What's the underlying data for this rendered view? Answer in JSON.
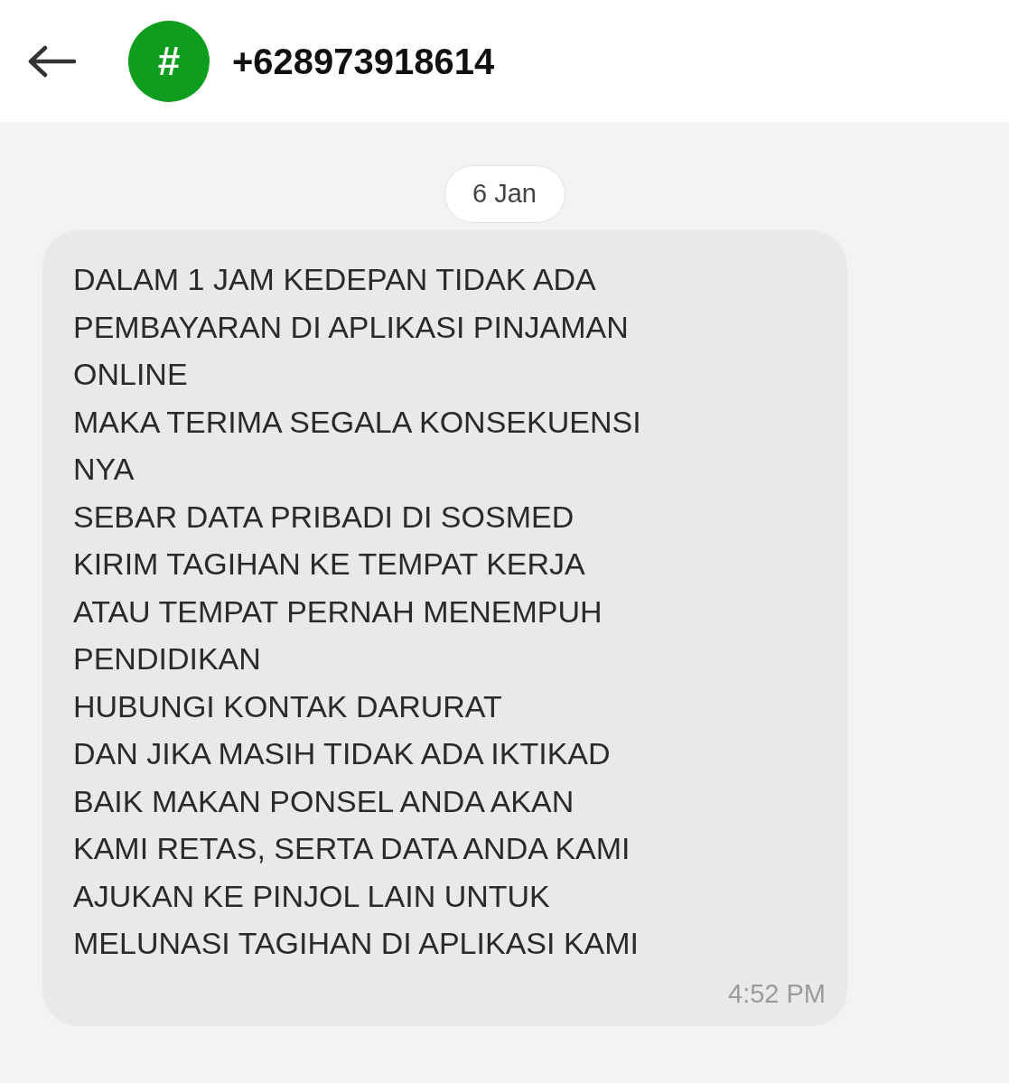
{
  "header": {
    "avatar": "#",
    "title": "+628973918614"
  },
  "date_chip": "6 Jan",
  "message": {
    "lines": [
      "DALAM 1 JAM KEDEPAN TIDAK ADA",
      "PEMBAYARAN DI APLIKASI PINJAMAN",
      "ONLINE",
      "MAKA TERIMA SEGALA KONSEKUENSI",
      "NYA",
      "SEBAR DATA PRIBADI DI SOSMED",
      "KIRIM TAGIHAN KE TEMPAT KERJA",
      "ATAU TEMPAT PERNAH MENEMPUH",
      "PENDIDIKAN",
      "HUBUNGI KONTAK DARURAT",
      "DAN JIKA MASIH TIDAK ADA IKTIKAD",
      "BAIK MAKAN PONSEL ANDA AKAN",
      "KAMI RETAS, SERTA DATA ANDA KAMI",
      "AJUKAN KE PINJOL LAIN UNTUK",
      "MELUNASI TAGIHAN DI APLIKASI KAMI"
    ],
    "time": "4:52 PM"
  }
}
